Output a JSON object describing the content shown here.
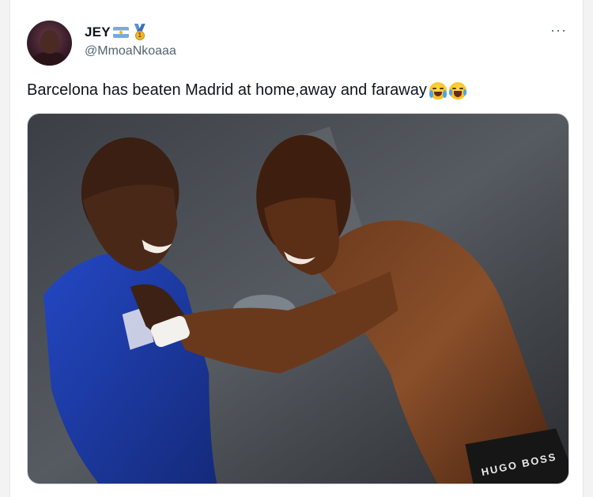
{
  "tweet": {
    "author": {
      "display_name": "JEY",
      "handle": "@MmoaNkoaaa",
      "badges": [
        "argentina-flag-icon",
        "first-place-medal-icon"
      ],
      "medal_number": "1"
    },
    "more_label": "···",
    "text": "Barcelona has beaten Madrid at home,away and faraway",
    "emojis": [
      "loudly-crying-face-icon",
      "face-with-tears-of-joy-icon"
    ],
    "media": {
      "type": "photo",
      "shorts_label": "HUGO BOSS"
    }
  },
  "colors": {
    "text_primary": "#0f1419",
    "text_secondary": "#536471",
    "jersey_blue": "#1f3fb0",
    "skin": "#5a3018"
  }
}
